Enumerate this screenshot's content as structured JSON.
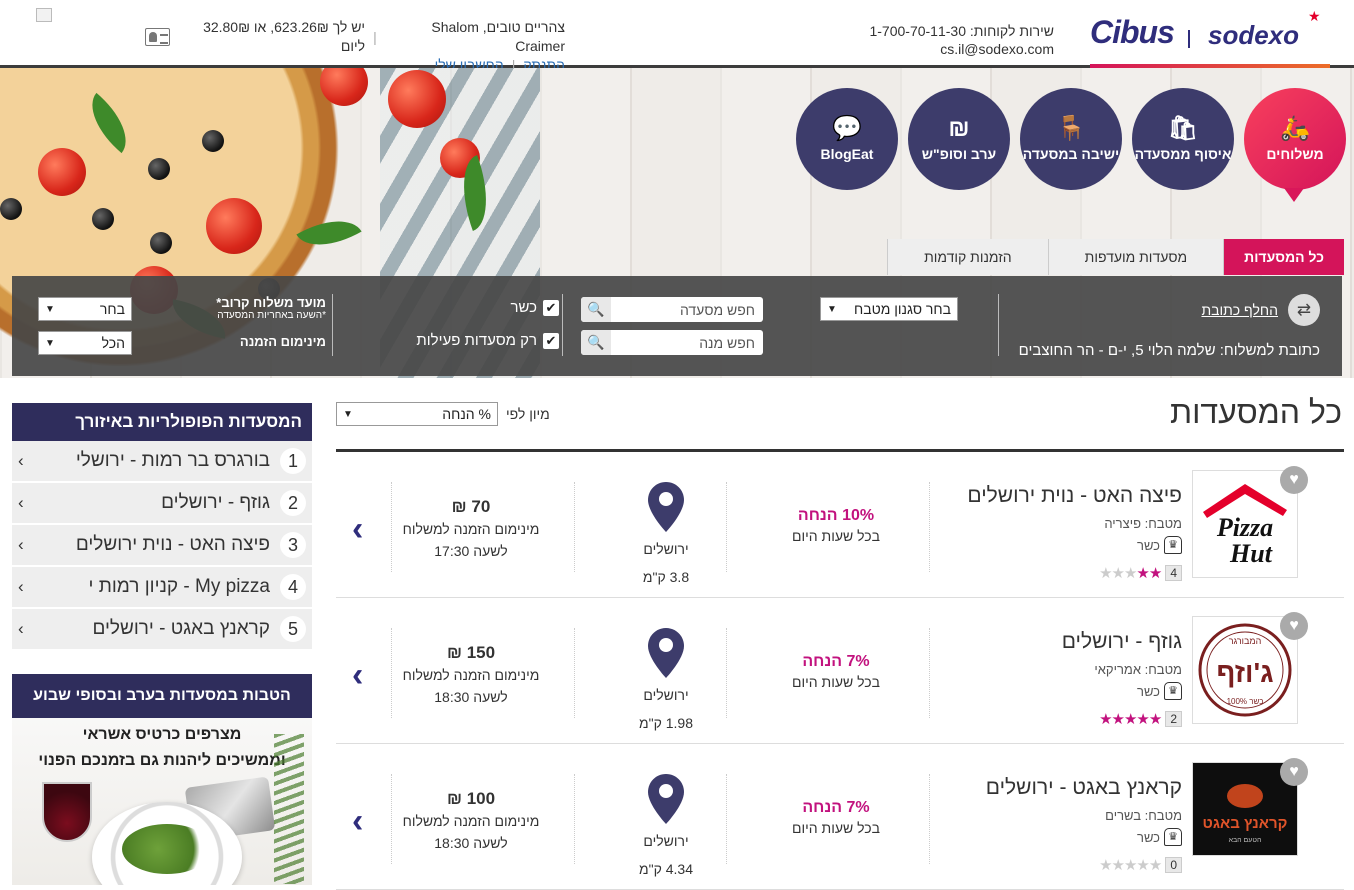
{
  "header": {
    "customer_service": "שירות לקוחות: 1-700-70-11-30",
    "email": "cs.il@sodexo.com",
    "greeting": "צהריים טובים, Shalom Craimer",
    "balance": "יש לך 623.26₪, או 32.80₪ ליום",
    "logout": "התנתק",
    "my_account": "החשבון שלי",
    "logo_cibus": "Cibus",
    "logo_sodexo": "sodexo"
  },
  "categories": [
    {
      "label": "משלוחים",
      "icon": "delivery-scooter-icon",
      "active": true
    },
    {
      "label": "איסוף ממסעדה",
      "icon": "shopping-bag-icon"
    },
    {
      "label": "ישיבה במסעדה",
      "icon": "chair-icon"
    },
    {
      "label": "ערב וסופ\"ש",
      "icon": "shekel-plate-icon"
    },
    {
      "label": "BlogEat",
      "icon": "chat-bubble-icon"
    }
  ],
  "tabs": [
    {
      "label": "כל המסעדות",
      "active": true
    },
    {
      "label": "מסעדות מועדפות"
    },
    {
      "label": "הזמנות קודמות"
    }
  ],
  "filters": {
    "change_address": "החלף כתובת",
    "address": "כתובת למשלוח: שלמה הלוי 5, י-ם - הר החוצבים",
    "cuisine_select": "בחר סגנון מטבח",
    "search_restaurant": "חפש מסעדה",
    "search_dish": "חפש מנה",
    "kosher": "כשר",
    "active_only": "רק מסעדות פעילות",
    "delivery_time_label": "מועד משלוח קרוב*",
    "delivery_time_note": "*השעה באחריות המסעדה",
    "delivery_time_value": "בחר",
    "min_order_label": "מינימום הזמנה",
    "min_order_value": "הכל"
  },
  "main": {
    "title": "כל המסעדות",
    "sort_label": "מיון לפי",
    "sort_value": "% הנחה"
  },
  "restaurants": [
    {
      "name": "פיצה האט - נוית ירושלים",
      "cuisine": "מטבח: פיצריה",
      "kosher": "כשר",
      "rating_count": "4",
      "stars": 2,
      "discount": "10% הנחה",
      "discount_sub": "בכל שעות היום",
      "city": "ירושלים",
      "distance": "3.8 ק\"מ",
      "min_amount": "70 ₪",
      "min_label": "מינימום הזמנה למשלוח",
      "time": "לשעה 17:30",
      "logo": "pizza-hut"
    },
    {
      "name": "גוזף - ירושלים",
      "cuisine": "מטבח: אמריקאי",
      "kosher": "כשר",
      "rating_count": "2",
      "stars": 5,
      "discount": "7% הנחה",
      "discount_sub": "בכל שעות היום",
      "city": "ירושלים",
      "distance": "1.98 ק\"מ",
      "min_amount": "150 ₪",
      "min_label": "מינימום הזמנה למשלוח",
      "time": "לשעה 18:30",
      "logo": "joseph"
    },
    {
      "name": "קראנץ באגט - ירושלים",
      "cuisine": "מטבח: בשרים",
      "kosher": "כשר",
      "rating_count": "0",
      "stars": 0,
      "discount": "7% הנחה",
      "discount_sub": "בכל שעות היום",
      "city": "ירושלים",
      "distance": "4.34 ק\"מ",
      "min_amount": "100 ₪",
      "min_label": "מינימום הזמנה למשלוח",
      "time": "לשעה 18:30",
      "logo": "crunch"
    }
  ],
  "sidebar": {
    "title": "המסעדות הפופולריות באיזורך",
    "items": [
      {
        "num": "1",
        "label": "בורגרס בר רמות - ירושלי"
      },
      {
        "num": "2",
        "label": "גוזף - ירושלים"
      },
      {
        "num": "3",
        "label": "פיצה האט - נוית ירושלים"
      },
      {
        "num": "4",
        "label": "My pizza - קניון רמות י"
      },
      {
        "num": "5",
        "label": "קראנץ באגט - ירושלים"
      }
    ]
  },
  "promo": {
    "title": "הטבות במסעדות בערב ובסופי שבוע",
    "line1": "מצרפים כרטיס אשראי",
    "line2": "וממשיכים ליהנות גם בזמנכם הפנוי"
  },
  "logos": {
    "pizza_hut_1": "Pizza",
    "pizza_hut_2": "Hut",
    "joseph_top": "המבורגר",
    "joseph_name": "ג'וזף",
    "joseph_bottom": "כשר 100%",
    "crunch_name": "קראנץ באגט",
    "crunch_sub": "הטעם הבא"
  },
  "colors": {
    "brand": "#2f2d7c",
    "accent": "#d4145a",
    "dark_bar": "#464646"
  }
}
